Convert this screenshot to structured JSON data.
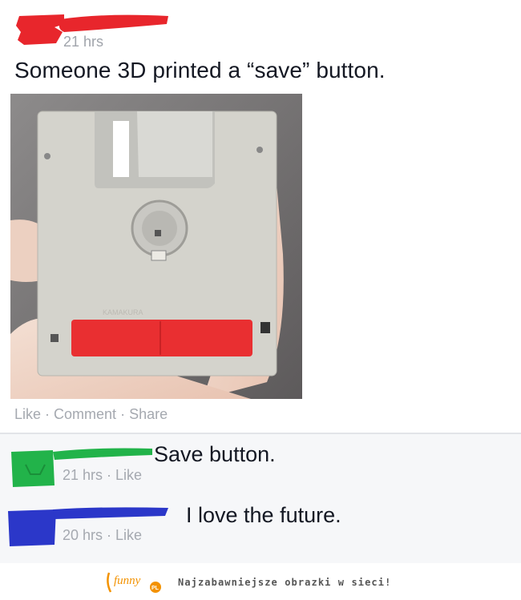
{
  "post": {
    "time": "21 hrs",
    "text": "Someone 3D printed a “save” button.",
    "photo_label": "KAMAKURA"
  },
  "actions": {
    "like": "Like",
    "comment": "Comment",
    "share": "Share",
    "separator": " · "
  },
  "comments": [
    {
      "text": "Save button.",
      "time": "21 hrs",
      "like": "Like",
      "avatar_color": "#22b34a"
    },
    {
      "text": "I love the future.",
      "time": "20 hrs",
      "like": "Like",
      "avatar_color": "#2b37c9"
    }
  ],
  "footer": {
    "logo_text": "funny",
    "logo_badge": "PL",
    "tagline": "Najzabawniejsze obrazki w sieci!"
  },
  "colors": {
    "redaction_red": "#e8262c",
    "floppy_body": "#d4d3cc",
    "floppy_red": "#e92f31",
    "muted_text": "#a5a9b0"
  }
}
